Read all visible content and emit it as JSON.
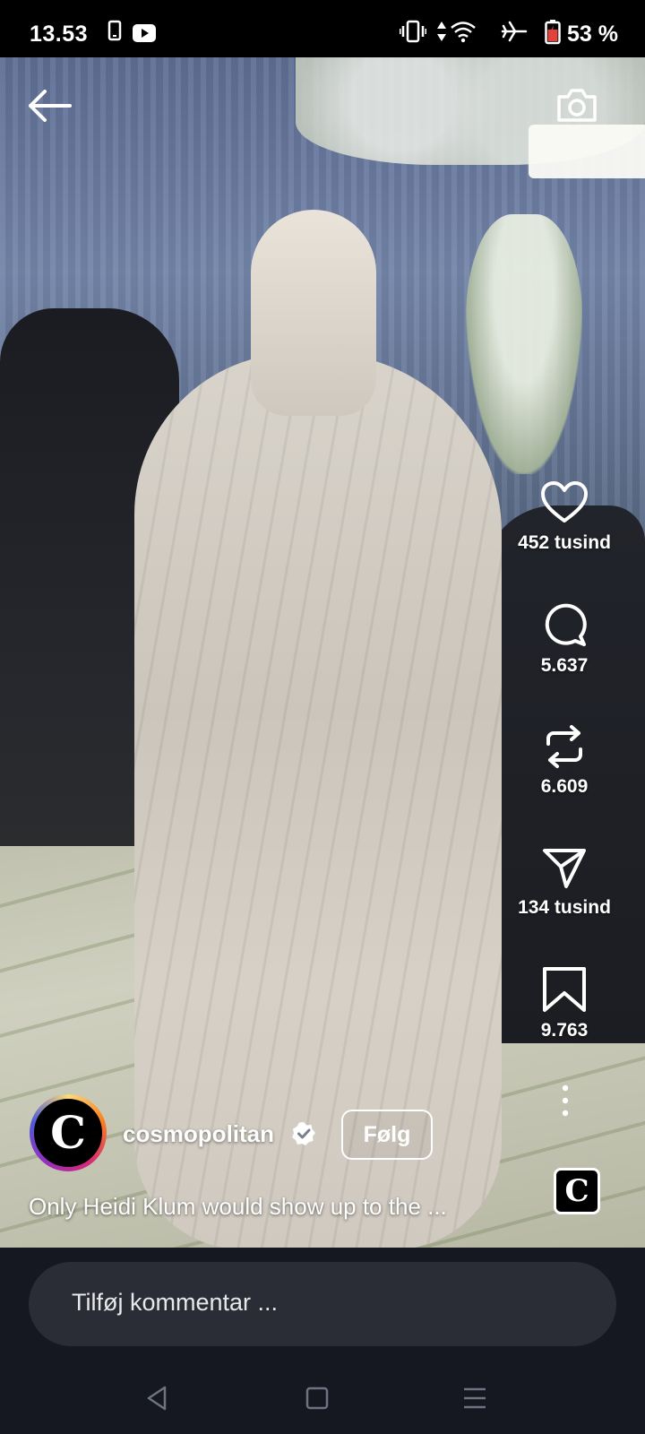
{
  "status_bar": {
    "time": "13.53",
    "battery_text": "53 %",
    "icons": [
      "phone-icon",
      "youtube-icon",
      "vibrate-icon",
      "data-arrows-icon",
      "wifi-icon",
      "airplane-icon",
      "battery-icon"
    ]
  },
  "top_bar": {
    "back_icon": "arrow-left-icon",
    "camera_icon": "camera-icon"
  },
  "actions": {
    "like_count": "452 tusind",
    "comment_count": "5.637",
    "repost_count": "6.609",
    "share_count": "134 tusind",
    "save_count": "9.763"
  },
  "post": {
    "avatar_letter": "C",
    "username": "cosmopolitan",
    "follow_label": "Følg",
    "caption": "Only Heidi Klum would show up to the ...",
    "audio_letter": "C"
  },
  "comment_bar": {
    "placeholder": "Tilføj kommentar ..."
  },
  "nav": {
    "icons": [
      "back-triangle-icon",
      "home-square-icon",
      "menu-lines-icon"
    ]
  },
  "colors": {
    "status_bg": "#000000",
    "bottom_bg": "#151820",
    "comment_box": "#2a2d35",
    "icon_white": "#ffffff"
  }
}
